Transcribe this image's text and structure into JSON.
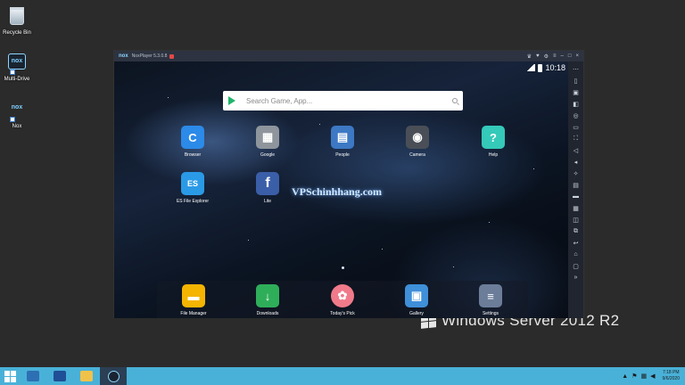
{
  "desktop": {
    "icons": [
      {
        "label": "Recycle Bin"
      },
      {
        "label": "Multi-Drive",
        "tile": "nox"
      },
      {
        "label": "Nox",
        "tile": "nox"
      }
    ],
    "server_watermark": "Windows Server 2012 R2"
  },
  "nox": {
    "logo": "nox",
    "version": "NoxPlayer 5.3.0.8",
    "status_time": "10:18",
    "search_placeholder": "Search Game, App...",
    "watermark": "VPSchinhhang.com",
    "apps": [
      {
        "name": "Browser",
        "color": "#2c8ae8",
        "glyph": "C"
      },
      {
        "name": "Google",
        "color": "#8f959c",
        "glyph": "▦"
      },
      {
        "name": "People",
        "color": "#3d78c4",
        "glyph": "▤"
      },
      {
        "name": "Camera",
        "color": "#4a4f57",
        "glyph": "◉"
      },
      {
        "name": "Help",
        "color": "#35c9b9",
        "glyph": "?"
      },
      {
        "name": "ES File Explorer",
        "color": "#2a9ae6",
        "glyph": "ES"
      },
      {
        "name": "Lite",
        "color": "#3b5ea8",
        "glyph": "f"
      }
    ],
    "dock": [
      {
        "name": "File Manager",
        "color": "#f4b400",
        "glyph": "▬"
      },
      {
        "name": "Downloads",
        "color": "#2fae5a",
        "glyph": "↓"
      },
      {
        "name": "Today's Pick",
        "color": "#f07a8a",
        "glyph": "✿"
      },
      {
        "name": "Gallery",
        "color": "#3f8fd9",
        "glyph": "▣"
      },
      {
        "name": "Settings",
        "color": "#6b7d99",
        "glyph": "≡"
      }
    ]
  },
  "taskbar": {
    "time": "7:18 PM",
    "date": "9/6/2020"
  }
}
